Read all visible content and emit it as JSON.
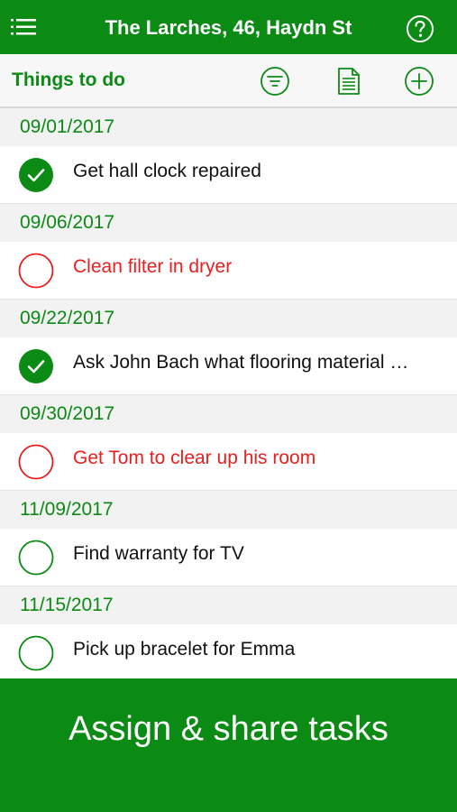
{
  "app": {
    "title": "The Larches, 46, Haydn St"
  },
  "toolbar": {
    "section_title": "Things to do"
  },
  "colors": {
    "brand_green": "#0b8a14",
    "overdue_red": "#e8201f"
  },
  "icons": {
    "menu": "menu-icon",
    "help": "help-icon",
    "filter": "filter-icon",
    "report": "document-icon",
    "add": "add-icon",
    "done": "check-circle-icon",
    "open": "empty-circle-icon"
  },
  "groups": [
    {
      "date": "09/01/2017",
      "tasks": [
        {
          "label": "Get hall clock repaired",
          "status": "done"
        }
      ]
    },
    {
      "date": "09/06/2017",
      "tasks": [
        {
          "label": "Clean filter in dryer",
          "status": "overdue"
        }
      ]
    },
    {
      "date": "09/22/2017",
      "tasks": [
        {
          "label": "Ask John Bach what flooring material …",
          "status": "done"
        }
      ]
    },
    {
      "date": "09/30/2017",
      "tasks": [
        {
          "label": "Get Tom to clear up his room",
          "status": "overdue"
        }
      ]
    },
    {
      "date": "11/09/2017",
      "tasks": [
        {
          "label": "Find warranty for TV",
          "status": "open"
        }
      ]
    },
    {
      "date": "11/15/2017",
      "tasks": [
        {
          "label": "Pick up bracelet for Emma",
          "status": "open"
        }
      ]
    }
  ],
  "banner": {
    "text": "Assign & share tasks"
  }
}
